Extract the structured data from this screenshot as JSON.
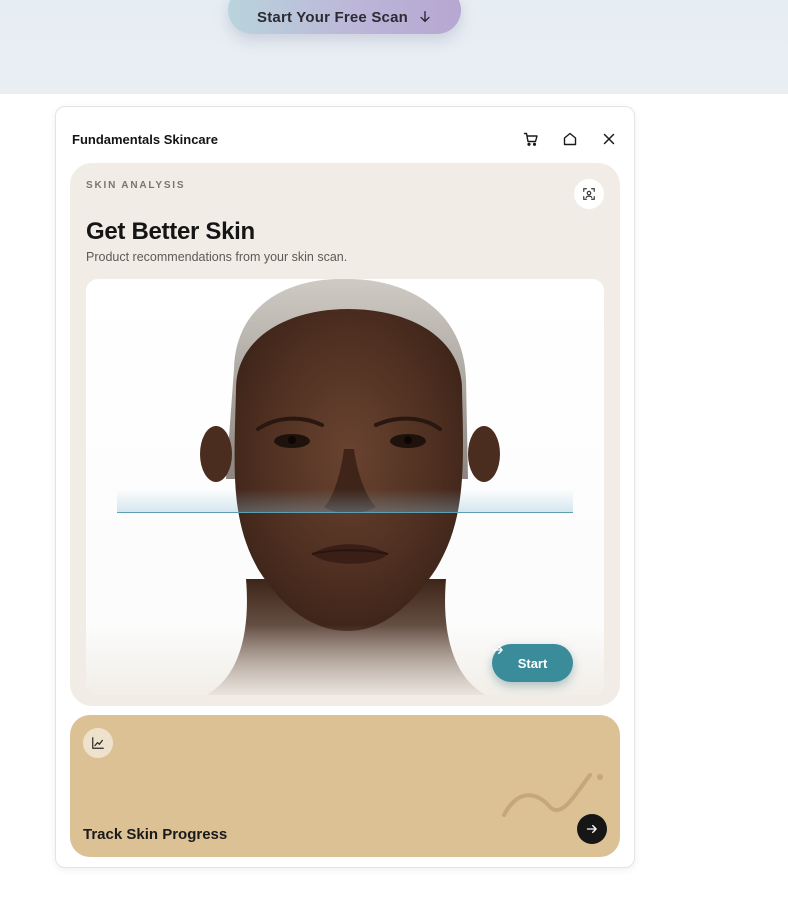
{
  "hero": {
    "cta_label": "Start Your Free Scan",
    "cta_icon": "arrow-down-icon"
  },
  "widget": {
    "brand": "Fundamentals Skincare",
    "header_icons": [
      "cart-icon",
      "home-icon",
      "close-icon"
    ],
    "analysis": {
      "eyebrow": "SKIN ANALYSIS",
      "title": "Get Better Skin",
      "subtitle": "Product recommendations from your skin scan.",
      "badge_icon": "face-scan-icon",
      "start_label": "Start",
      "accent": "#3b8c9a"
    },
    "progress": {
      "title": "Track Skin Progress",
      "badge_icon": "line-chart-icon",
      "card_color": "#dcc195"
    }
  }
}
